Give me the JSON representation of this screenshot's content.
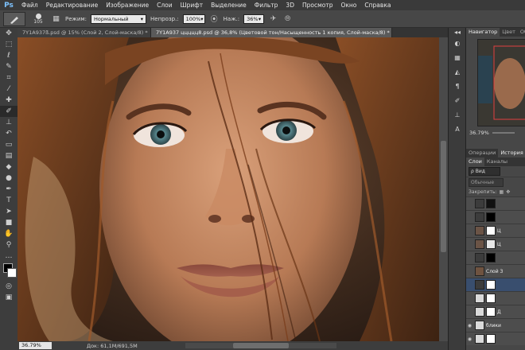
{
  "app": {
    "logo": "Ps"
  },
  "menu": [
    "Файл",
    "Редактирование",
    "Изображение",
    "Слои",
    "Шрифт",
    "Выделение",
    "Фильтр",
    "3D",
    "Просмотр",
    "Окно",
    "Справка"
  ],
  "options": {
    "brush_size": "105",
    "mode_label": "Режим:",
    "mode_value": "Нормальный",
    "opacity_label": "Непрозр.:",
    "opacity_value": "100%",
    "pressure_label": "Наж.:",
    "pressure_value": "36%"
  },
  "tabs": [
    {
      "title": "7Y1A937ß.psd @ 15% (Слой 2, Слой-маска/8) *",
      "close": "×"
    },
    {
      "title": "7Y1A937 ццццц8.psd @ 36,8% (Цветовой тон/Насыщенность 1 копия, Слой-маска/8) *",
      "close": "×"
    }
  ],
  "status": {
    "zoom": "36.79%",
    "doc": "Док: 61,1M/691,5M"
  },
  "panels": {
    "navigator_tabs": [
      "Навигатор",
      "Цвет",
      "Образ"
    ],
    "navigator_zoom": "36.79%",
    "history_tabs": [
      "Операции",
      "История"
    ],
    "layers_tabs": [
      "Слои",
      "Каналы"
    ],
    "filter_label": "ρ Вид",
    "blend_label": "Обычные",
    "lock_label": "Закрепить:",
    "layers": [
      {
        "name": "",
        "thumb": "#3c3c3c",
        "mask": "#111111",
        "visible": false,
        "selected": false
      },
      {
        "name": "",
        "thumb": "#3c3c3c",
        "mask": "#000000",
        "visible": false,
        "selected": false
      },
      {
        "name": "Ц",
        "thumb": "#6b5446",
        "mask": "#ffffff",
        "visible": false,
        "selected": false
      },
      {
        "name": "Ц",
        "thumb": "#6b5446",
        "mask": "#e8e8e8",
        "visible": false,
        "selected": false
      },
      {
        "name": "",
        "thumb": "#3c3c3c",
        "mask": "#000000",
        "visible": false,
        "selected": false
      },
      {
        "name": "Слой 3",
        "thumb": "#6f5340",
        "mask": "",
        "visible": false,
        "selected": false
      },
      {
        "name": "",
        "thumb": "#3c3c3c",
        "mask": "#ffffff",
        "visible": false,
        "selected": true
      },
      {
        "name": "",
        "thumb": "#d9d9d9",
        "mask": "#ffffff",
        "visible": false,
        "selected": false
      },
      {
        "name": "Д",
        "thumb": "#d9d9d9",
        "mask": "#ffffff",
        "visible": false,
        "selected": false
      },
      {
        "name": "блики",
        "thumb": "#d9d9d9",
        "mask": "",
        "visible": true,
        "selected": false
      },
      {
        "name": "",
        "thumb": "#d9d9d9",
        "mask": "#ffffff",
        "visible": true,
        "selected": false
      }
    ]
  },
  "colors": {
    "accent": "#7ec3ff",
    "selected_layer": "#394e6e"
  }
}
